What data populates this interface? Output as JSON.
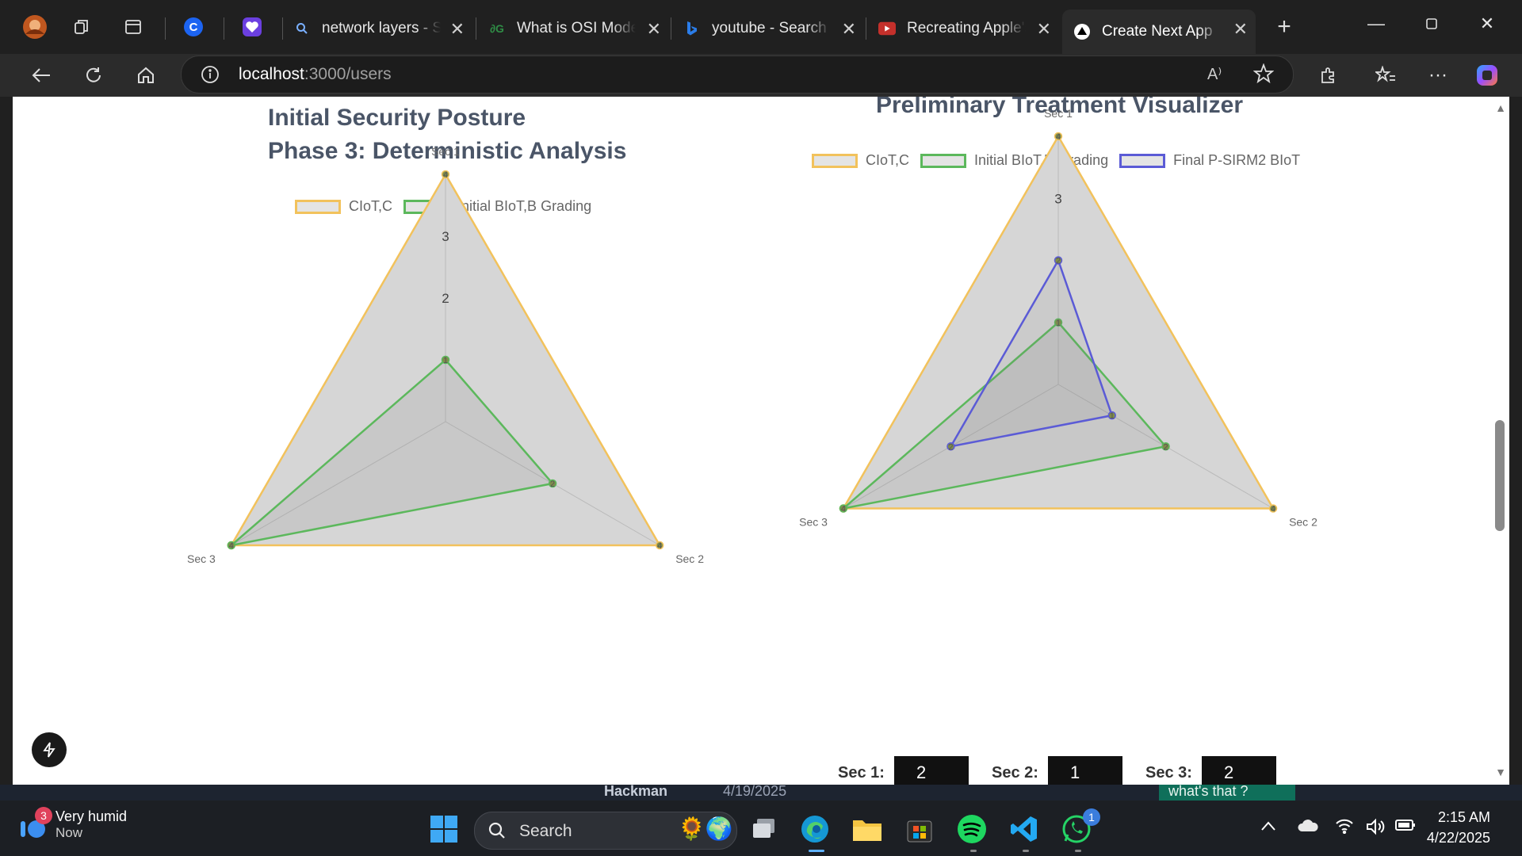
{
  "browser": {
    "tabs": [
      {
        "title": "network layers - Se",
        "favicon": "search-icon"
      },
      {
        "title": "What is OSI Model?",
        "favicon": "geeksforgeeks-icon"
      },
      {
        "title": "youtube - Search",
        "favicon": "bing-icon"
      },
      {
        "title": "Recreating Apple's",
        "favicon": "youtube-icon"
      },
      {
        "title": "Create Next App",
        "favicon": "nextjs-icon",
        "active": true
      }
    ],
    "url_host": "localhost",
    "url_path": ":3000/users"
  },
  "page": {
    "left_chart": {
      "title_line1": "Initial Security Posture",
      "title_line2": "Phase 3: Deterministic Analysis"
    },
    "right_chart": {
      "title": "Preliminary Treatment Visualizer"
    },
    "values": [
      {
        "label": "Sec 1:",
        "value": "2"
      },
      {
        "label": "Sec 2:",
        "value": "1"
      },
      {
        "label": "Sec 3:",
        "value": "2"
      }
    ]
  },
  "chart_data": [
    {
      "type": "radar",
      "title": "Initial Security Posture Phase 3: Deterministic Analysis",
      "categories": [
        "Sec 1",
        "Sec 2",
        "Sec 3"
      ],
      "rlim": [
        0,
        4
      ],
      "ticks": [
        "2",
        "3"
      ],
      "series": [
        {
          "name": "CIoT,C",
          "values": [
            4,
            4,
            4
          ],
          "color": "#f2c25c"
        },
        {
          "name": "Initial BIoT,B Grading",
          "values": [
            1,
            2,
            4
          ],
          "color": "#5cb85c"
        }
      ]
    },
    {
      "type": "radar",
      "title": "Preliminary Treatment Visualizer",
      "categories": [
        "Sec 1",
        "Sec 2",
        "Sec 3"
      ],
      "rlim": [
        0,
        4
      ],
      "ticks": [
        "3"
      ],
      "series": [
        {
          "name": "CIoT,C",
          "values": [
            4,
            4,
            4
          ],
          "color": "#f2c25c"
        },
        {
          "name": "Initial BIoT,B Grading",
          "values": [
            1,
            2,
            4
          ],
          "color": "#5cb85c"
        },
        {
          "name": "Final P-SIRM2 BIoT",
          "values": [
            2,
            1,
            2
          ],
          "color": "#5b5bd6"
        }
      ]
    }
  ],
  "taskbar": {
    "weather_title": "Very humid",
    "weather_sub": "Now",
    "weather_badge": "3",
    "search_label": "Search",
    "whatsapp_badge": "1",
    "time": "2:15 AM",
    "date": "4/22/2025",
    "peek_name": "Hackman",
    "peek_date": "4/19/2025",
    "peek_msg": "what's that ?"
  }
}
